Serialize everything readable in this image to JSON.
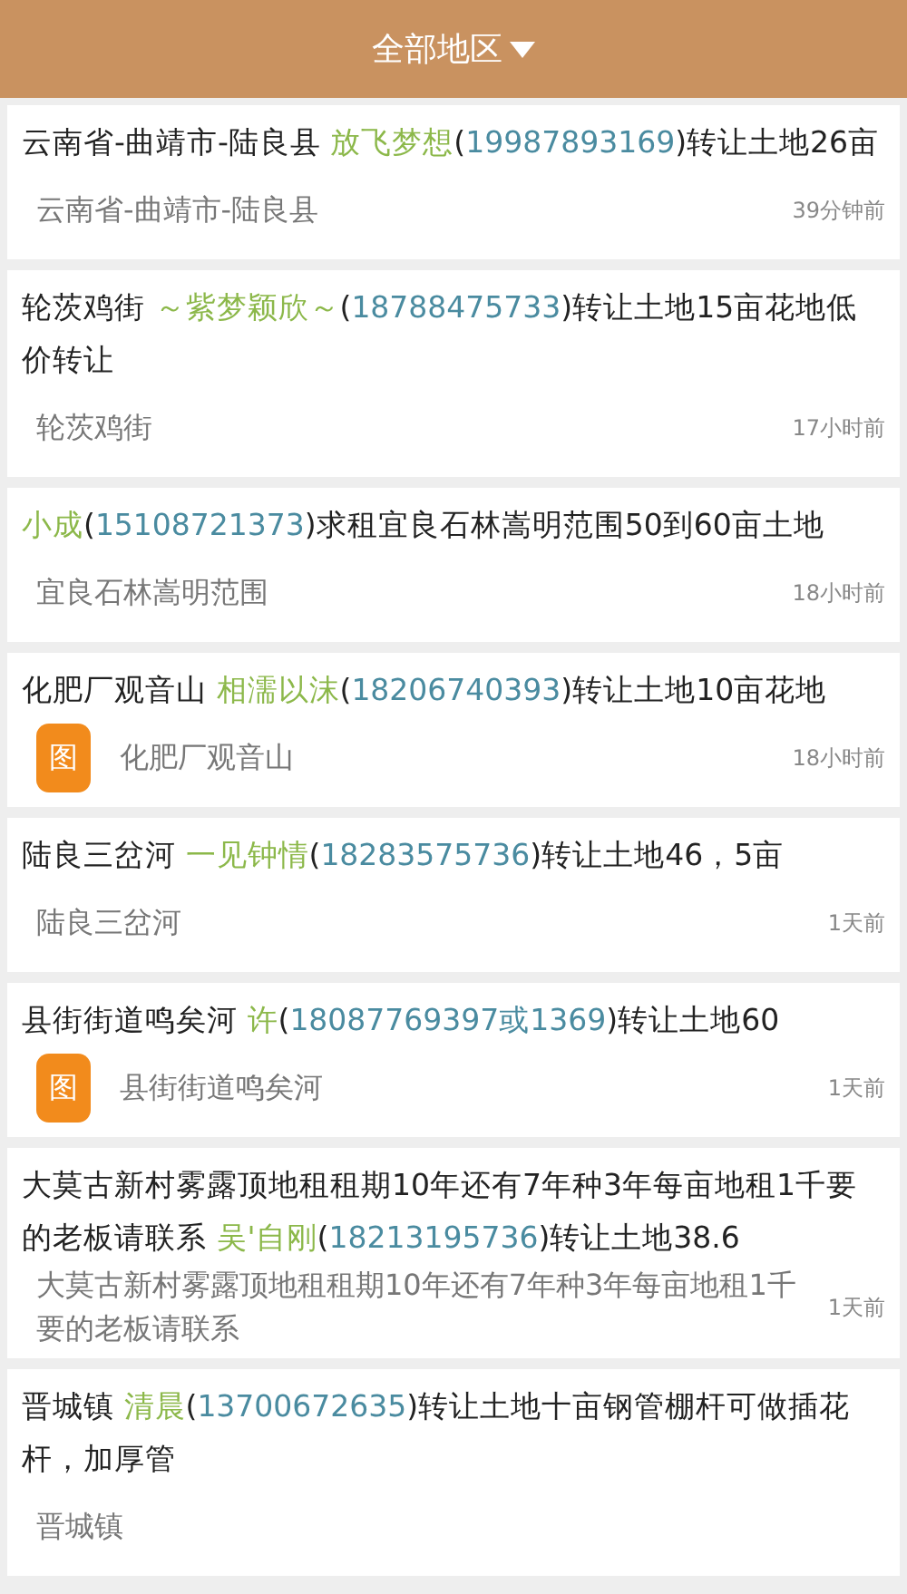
{
  "header": {
    "title": "全部地区"
  },
  "posts": [
    {
      "title_parts": [
        {
          "kind": "plain",
          "text": "云南省-曲靖市-陆良县 "
        },
        {
          "kind": "name",
          "text": "放飞梦想"
        },
        {
          "kind": "plain",
          "text": "("
        },
        {
          "kind": "phone",
          "text": "19987893169"
        },
        {
          "kind": "plain",
          "text": ")转让土地26亩"
        }
      ],
      "location": "云南省-曲靖市-陆良县",
      "time": "39分钟前",
      "has_image": false
    },
    {
      "title_parts": [
        {
          "kind": "plain",
          "text": "轮茨鸡街 "
        },
        {
          "kind": "name",
          "text": "～紫梦颖欣～"
        },
        {
          "kind": "plain",
          "text": "("
        },
        {
          "kind": "phone",
          "text": "18788475733"
        },
        {
          "kind": "plain",
          "text": ")转让土地15亩花地低价转让"
        }
      ],
      "location": "轮茨鸡街",
      "time": "17小时前",
      "has_image": false
    },
    {
      "title_parts": [
        {
          "kind": "name",
          "text": "小成"
        },
        {
          "kind": "plain",
          "text": "("
        },
        {
          "kind": "phone",
          "text": "15108721373"
        },
        {
          "kind": "plain",
          "text": ")求租宜良石林嵩明范围50到60亩土地"
        }
      ],
      "location": "宜良石林嵩明范围",
      "time": "18小时前",
      "has_image": false
    },
    {
      "title_parts": [
        {
          "kind": "plain",
          "text": "化肥厂观音山 "
        },
        {
          "kind": "name",
          "text": "相濡以沫"
        },
        {
          "kind": "plain",
          "text": "("
        },
        {
          "kind": "phone",
          "text": "18206740393"
        },
        {
          "kind": "plain",
          "text": ")转让土地10亩花地"
        }
      ],
      "location": "化肥厂观音山",
      "time": "18小时前",
      "has_image": true,
      "image_label": "图"
    },
    {
      "title_parts": [
        {
          "kind": "plain",
          "text": "陆良三岔河 "
        },
        {
          "kind": "name",
          "text": "一见钟情"
        },
        {
          "kind": "plain",
          "text": "("
        },
        {
          "kind": "phone",
          "text": "18283575736"
        },
        {
          "kind": "plain",
          "text": ")转让土地46，5亩"
        }
      ],
      "location": "陆良三岔河",
      "time": "1天前",
      "has_image": false
    },
    {
      "title_parts": [
        {
          "kind": "plain",
          "text": "县街街道鸣矣河 "
        },
        {
          "kind": "name",
          "text": "许"
        },
        {
          "kind": "plain",
          "text": "("
        },
        {
          "kind": "phone",
          "text": "18087769397或1369"
        },
        {
          "kind": "plain",
          "text": ")转让土地60"
        }
      ],
      "location": "县街街道鸣矣河",
      "time": "1天前",
      "has_image": true,
      "image_label": "图"
    },
    {
      "title_parts": [
        {
          "kind": "plain",
          "text": "大莫古新村雾露顶地租租期10年还有7年种3年每亩地租1千要的老板请联系 "
        },
        {
          "kind": "name",
          "text": "吴'自刚"
        },
        {
          "kind": "plain",
          "text": "("
        },
        {
          "kind": "phone",
          "text": "18213195736"
        },
        {
          "kind": "plain",
          "text": ")转让土地38.6"
        }
      ],
      "location": "大莫古新村雾露顶地租租期10年还有7年种3年每亩地租1千要的老板请联系",
      "time": "1天前",
      "has_image": false
    },
    {
      "title_parts": [
        {
          "kind": "plain",
          "text": "晋城镇 "
        },
        {
          "kind": "name",
          "text": "清晨"
        },
        {
          "kind": "plain",
          "text": "("
        },
        {
          "kind": "phone",
          "text": "13700672635"
        },
        {
          "kind": "plain",
          "text": ")转让土地十亩钢管棚杆可做插花杆，加厚管"
        }
      ],
      "location": "晋城镇",
      "has_image": false
    }
  ]
}
